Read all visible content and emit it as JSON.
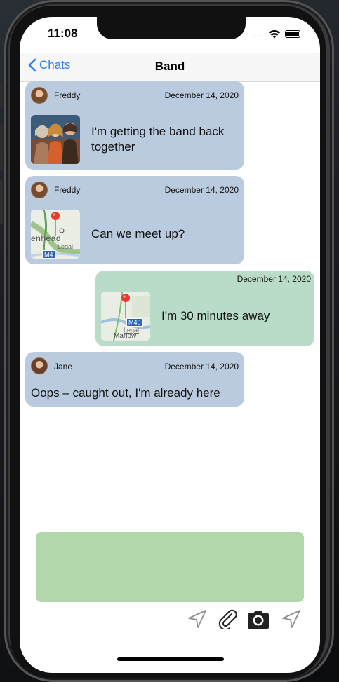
{
  "status": {
    "time": "11:08",
    "signal": "....",
    "icons": [
      "wifi-icon",
      "battery-icon"
    ]
  },
  "navbar": {
    "back_label": "Chats",
    "title": "Band"
  },
  "messages": [
    {
      "direction": "incoming",
      "sender": "Freddy",
      "date": "December 14, 2020",
      "attachment": "photo",
      "text_line1": "I'm getting the band back",
      "text_line2": "together"
    },
    {
      "direction": "incoming",
      "sender": "Freddy",
      "date": "December 14, 2020",
      "attachment": "map",
      "map_label_main": "enhead",
      "map_label_legal": "Legal",
      "map_label_road": "M4",
      "text": "Can we meet up?"
    },
    {
      "direction": "outgoing",
      "date": "December 14, 2020",
      "attachment": "map",
      "map_label_road": "M40",
      "map_label_legal": "Legal",
      "map_label_main": "Marlow",
      "text": "I'm 30 minutes away"
    },
    {
      "direction": "incoming",
      "sender": "Jane",
      "date": "December 14, 2020",
      "text": "Oops – caught out, I'm already here"
    }
  ],
  "composer": {
    "value": ""
  },
  "toolbar": {
    "icons": [
      "location-arrow-icon",
      "paperclip-icon",
      "camera-icon",
      "send-icon"
    ]
  },
  "colors": {
    "incoming_bubble": "#bacbdf",
    "outgoing_bubble": "#b9dcc8",
    "composer": "#b1d7ab",
    "accent": "#2f7cf6"
  }
}
